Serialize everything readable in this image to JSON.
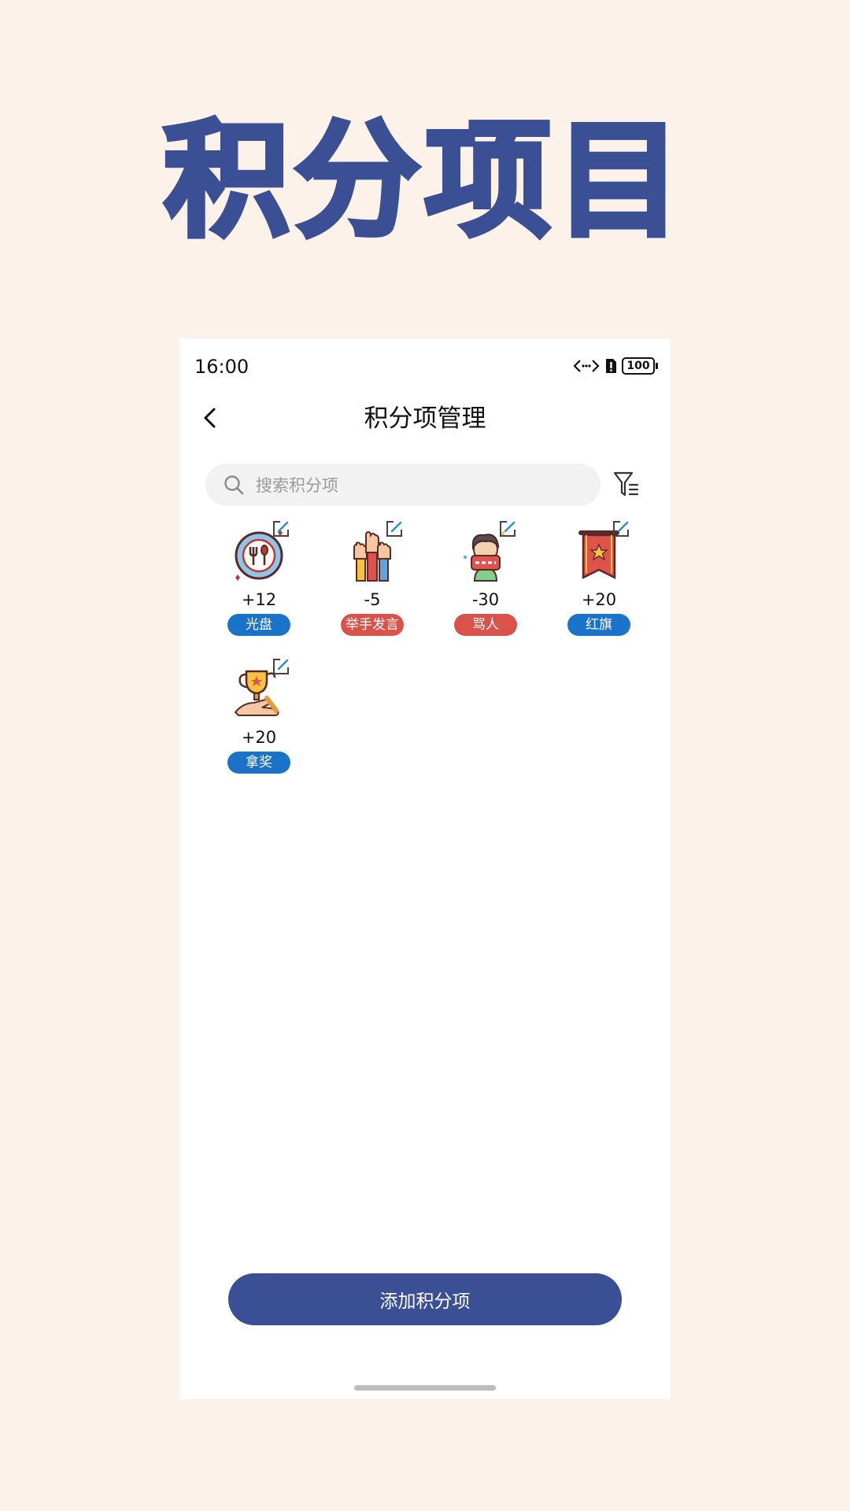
{
  "promo": {
    "title": "积分项目"
  },
  "status_bar": {
    "time": "16:00",
    "battery": "100"
  },
  "header": {
    "title": "积分项管理"
  },
  "search": {
    "placeholder": "搜索积分项",
    "value": ""
  },
  "items": [
    {
      "score": "+12",
      "label": "光盘",
      "tag_color": "#1a73c8",
      "icon": "clean-plate-icon"
    },
    {
      "score": "-5",
      "label": "举手发言",
      "tag_color": "#d9534a",
      "icon": "raised-hands-icon"
    },
    {
      "score": "-30",
      "label": "骂人",
      "tag_color": "#d9534a",
      "icon": "cursing-person-icon"
    },
    {
      "score": "+20",
      "label": "红旗",
      "tag_color": "#1a73c8",
      "icon": "red-flag-icon"
    },
    {
      "score": "+20",
      "label": "拿奖",
      "tag_color": "#1a73c8",
      "icon": "trophy-icon"
    }
  ],
  "add_button": {
    "label": "添加积分项"
  },
  "colors": {
    "accent": "#3a4f94",
    "positive_tag": "#1a73c8",
    "negative_tag": "#d9534a",
    "page_bg": "#fdf2e9"
  }
}
